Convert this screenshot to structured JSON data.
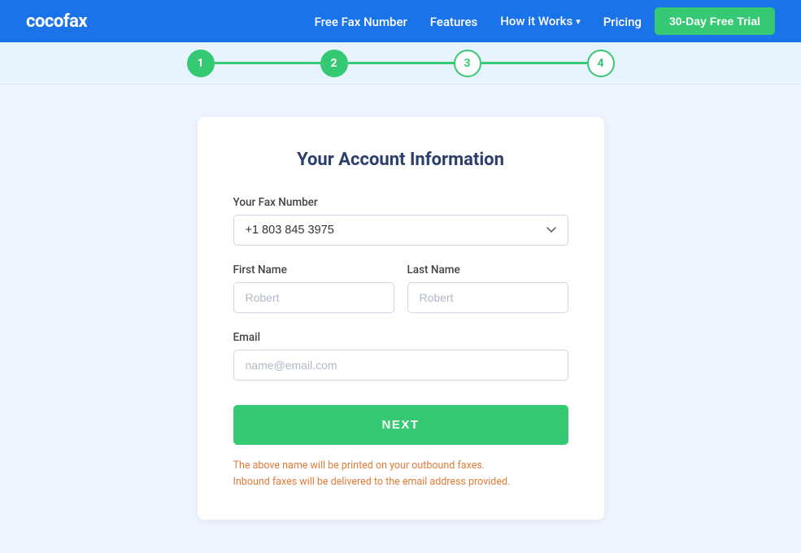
{
  "navbar": {
    "logo": "cocofax",
    "links": [
      {
        "label": "Free Fax Number",
        "hasArrow": false
      },
      {
        "label": "Features",
        "hasArrow": false
      },
      {
        "label": "How it Works",
        "hasArrow": true
      },
      {
        "label": "Pricing",
        "hasArrow": false
      }
    ],
    "trial_button": "30-Day Free Trial"
  },
  "stepper": {
    "steps": [
      "1",
      "2",
      "3",
      "4"
    ],
    "active_step": 2
  },
  "form": {
    "title": "Your Account Information",
    "fax_label": "Your Fax Number",
    "fax_value": "+1 803 845 3975",
    "first_name_label": "First Name",
    "first_name_placeholder": "Robert",
    "last_name_label": "Last Name",
    "last_name_placeholder": "Robert",
    "email_label": "Email",
    "email_placeholder": "name@email.com",
    "next_button": "NEXT",
    "note_line1": "The above name will be printed on your outbound faxes.",
    "note_line2": "Inbound faxes will be delivered to the email address provided."
  },
  "chevron_icon": "▾"
}
